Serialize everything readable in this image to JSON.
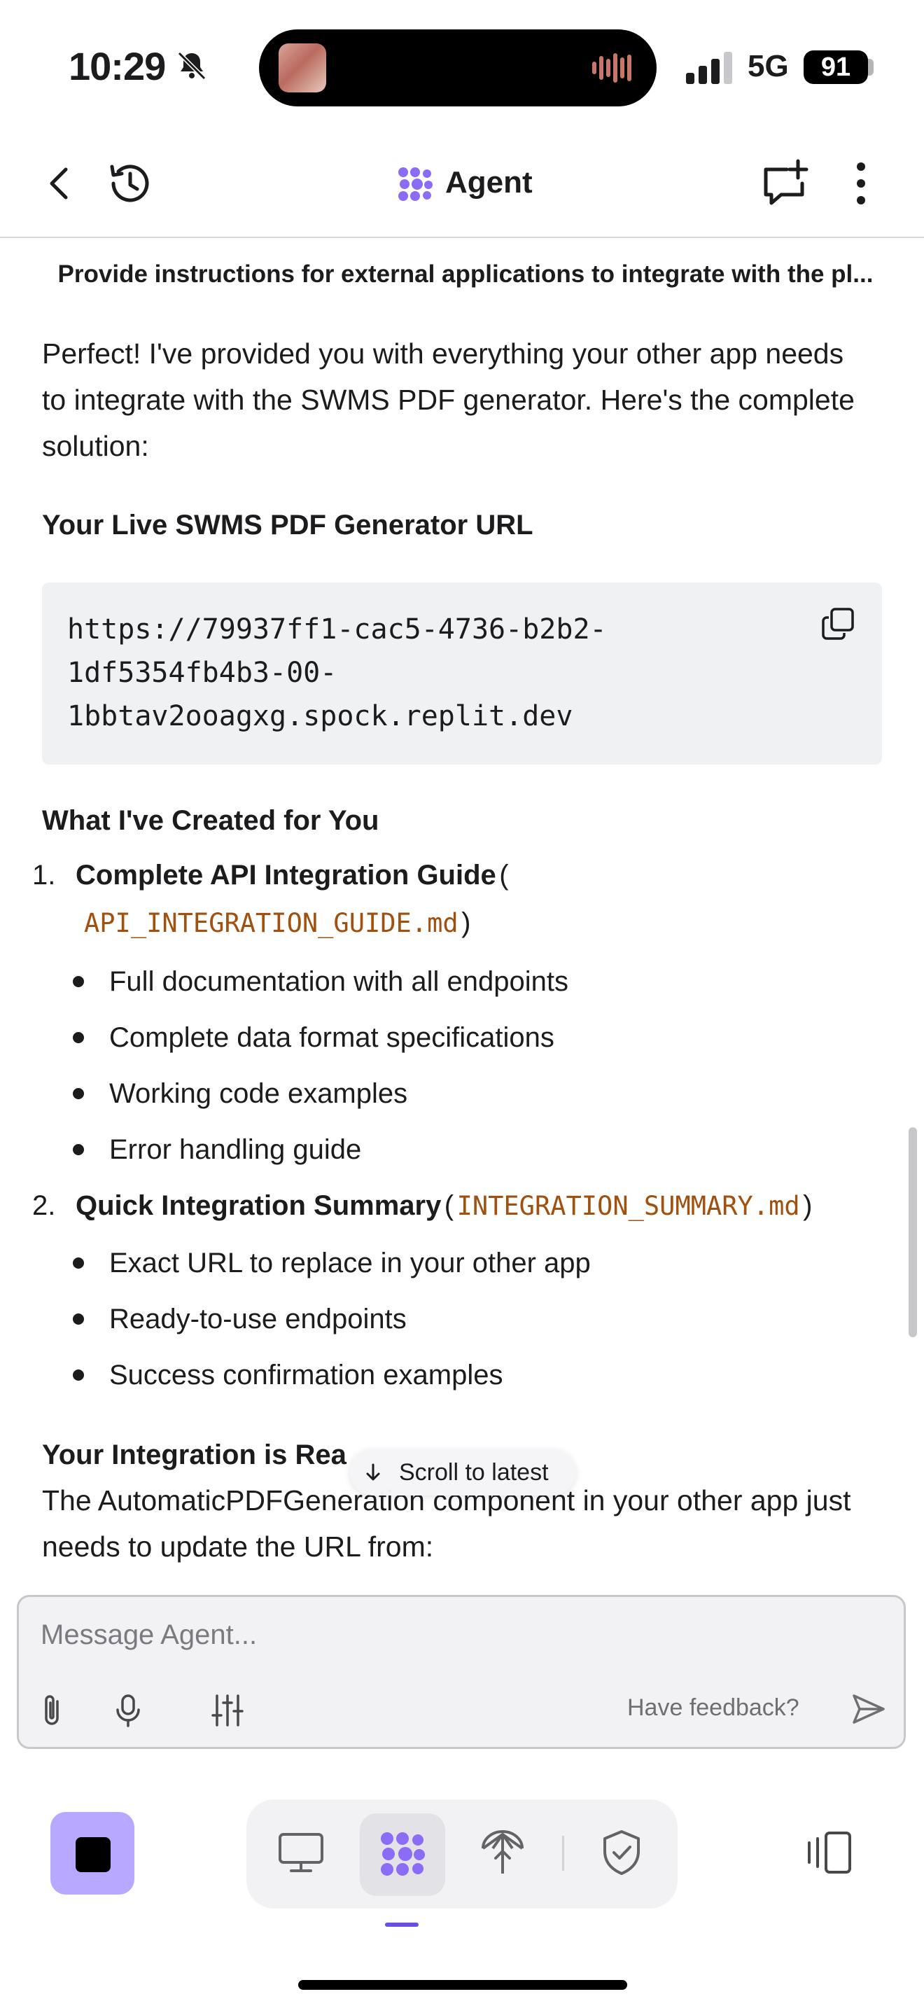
{
  "status_bar": {
    "time": "10:29",
    "network": "5G",
    "battery": "91"
  },
  "header": {
    "title": "Agent"
  },
  "context_title": "Provide instructions for external applications to integrate with the pl...",
  "message": {
    "intro": [
      "Perfect! I've provided you with everything your other app needs",
      "to integrate with the SWMS PDF generator. Here's the complete",
      "solution:"
    ],
    "url_heading": "Your Live SWMS PDF Generator URL",
    "url_lines": [
      "https://79937ff1-cac5-4736-b2b2-",
      "1df5354fb4b3-00-",
      "1bbtav2ooagxg.spock.replit.dev"
    ],
    "created_heading": "What I've Created for You",
    "items": [
      {
        "number": "1.",
        "title": "Complete API Integration Guide",
        "open": "(",
        "file": "API_INTEGRATION_GUIDE.md",
        "close": ")",
        "bullets": [
          "Full documentation with all endpoints",
          "Complete data format specifications",
          "Working code examples",
          "Error handling guide"
        ]
      },
      {
        "number": "2.",
        "title": "Quick Integration Summary",
        "open": "(",
        "file": "INTEGRATION_SUMMARY.md",
        "close": ")",
        "bullets": [
          "Exact URL to replace in your other app",
          "Ready-to-use endpoints",
          "Success confirmation examples"
        ]
      }
    ],
    "ready_heading": "Your Integration is Rea",
    "ready_lines": [
      "The AutomaticPDFGeneration component in your other app just",
      "needs to update the URL from:"
    ]
  },
  "scroll_to_latest": "Scroll to latest",
  "composer": {
    "placeholder": "Message Agent...",
    "feedback": "Have feedback?"
  },
  "colors": {
    "accent": "#8b6cf6",
    "stop_button": "#b8a8ff",
    "code_file": "#a1510f"
  },
  "icons": [
    "back-icon",
    "history-icon",
    "agent-logo-icon",
    "new-chat-icon",
    "more-icon",
    "copy-icon",
    "attach-icon",
    "microphone-icon",
    "settings-sliders-icon",
    "send-icon",
    "desktop-icon",
    "agent-icon",
    "deploy-icon",
    "security-icon",
    "panel-toggle-icon"
  ]
}
